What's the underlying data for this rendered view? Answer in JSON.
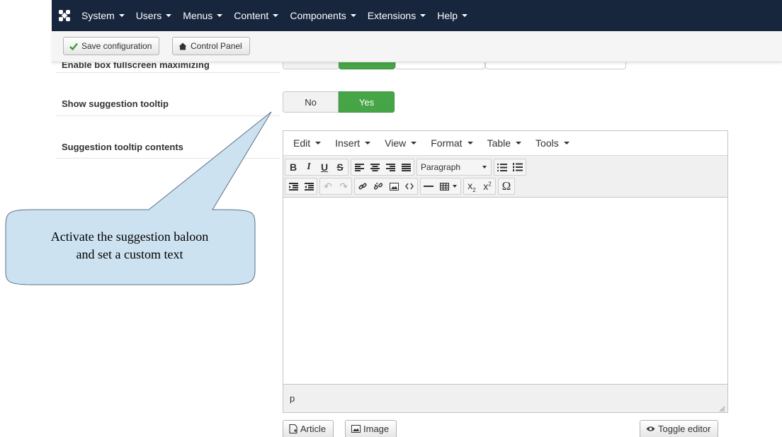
{
  "navbar": {
    "logo_icon": "joomla-logo-icon",
    "items": [
      {
        "label": "System"
      },
      {
        "label": "Users"
      },
      {
        "label": "Menus"
      },
      {
        "label": "Content"
      },
      {
        "label": "Components"
      },
      {
        "label": "Extensions"
      },
      {
        "label": "Help"
      }
    ]
  },
  "toolbar": {
    "save_label": "Save configuration",
    "save_icon": "checkmark-icon",
    "control_panel_label": "Control Panel",
    "control_panel_icon": "home-icon"
  },
  "form": {
    "hidden_label": "Enable box fullscreen maximizing",
    "show_tooltip_label": "Show suggestion tooltip",
    "toggle_no": "No",
    "toggle_yes": "Yes",
    "toggle_selected": "Yes",
    "tooltip_contents_label": "Suggestion tooltip contents"
  },
  "editor": {
    "menus": [
      "Edit",
      "Insert",
      "View",
      "Format",
      "Table",
      "Tools"
    ],
    "format_select": "Paragraph",
    "status_path": "p"
  },
  "buttons": {
    "article": "Article",
    "image": "Image",
    "toggle_editor": "Toggle editor"
  },
  "callout": {
    "line1": "Activate the suggestion baloon",
    "line2": "and set a custom text"
  },
  "colors": {
    "nav_bg": "#17253d",
    "toggle_yes": "#46a546",
    "callout_fill": "#cde2f0"
  }
}
